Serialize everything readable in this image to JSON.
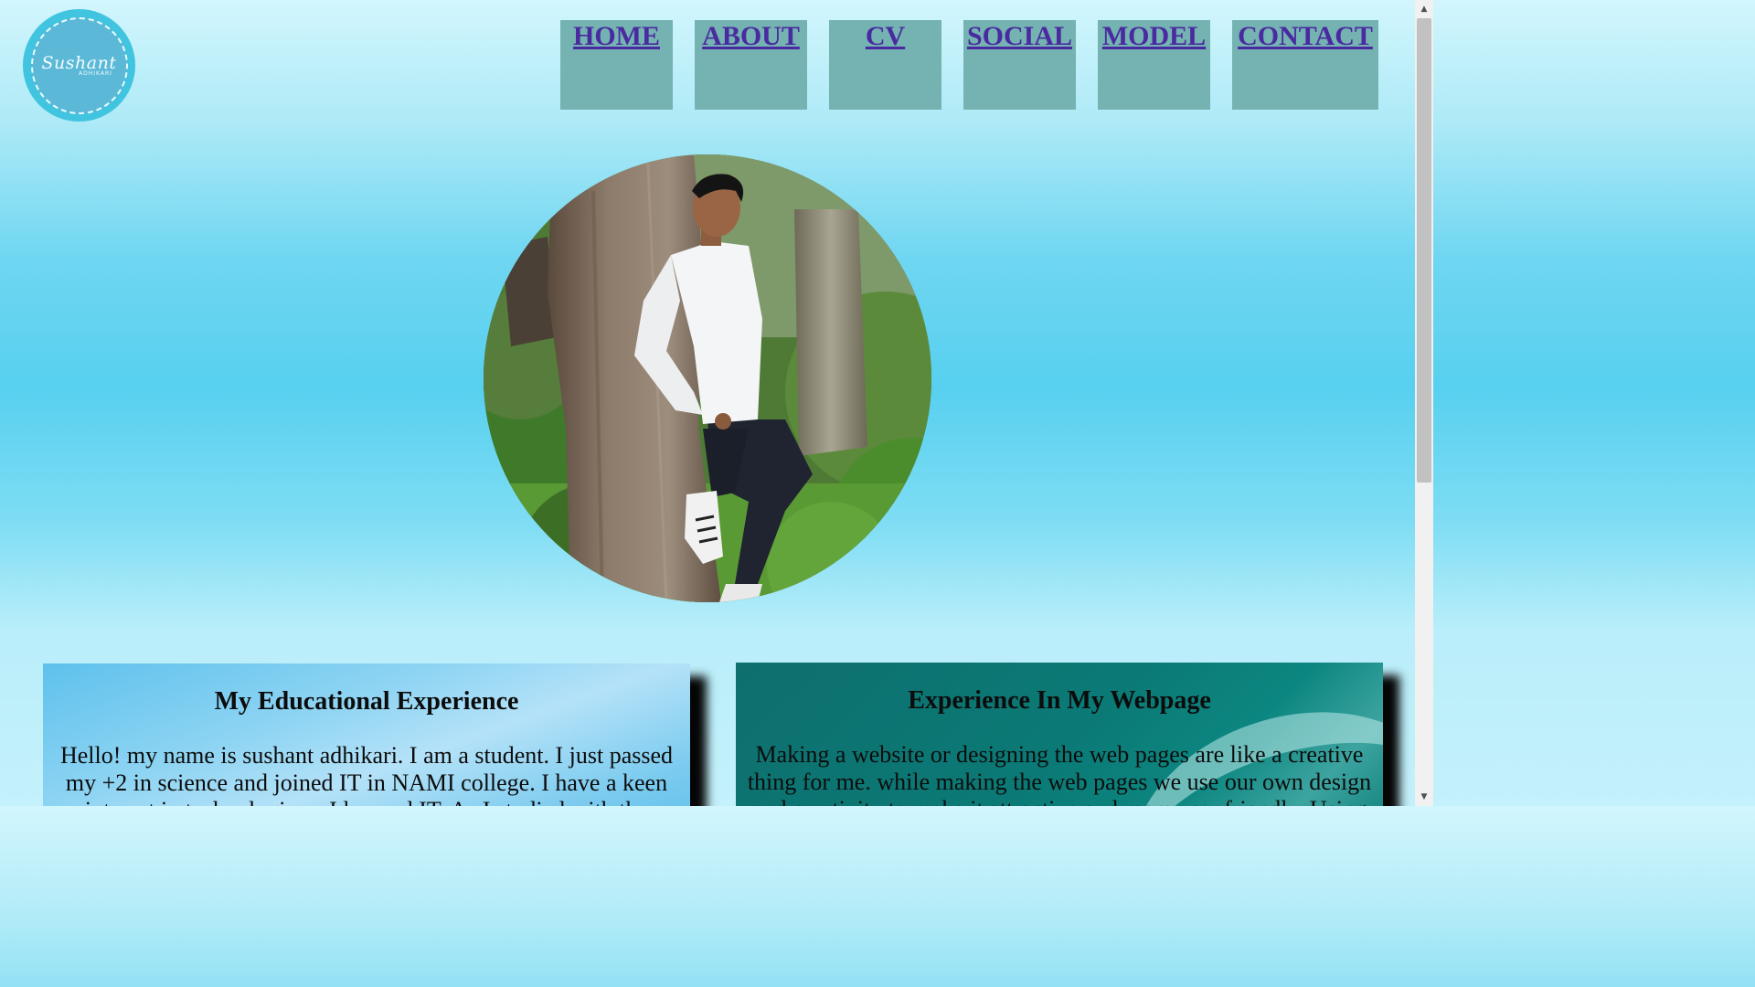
{
  "logo": {
    "script_text": "Sushant",
    "small_text": "ADHIKARI"
  },
  "nav": {
    "items": [
      {
        "label": "HOME"
      },
      {
        "label": "ABOUT"
      },
      {
        "label": "CV"
      },
      {
        "label": "SOCIAL"
      },
      {
        "label": "MODEL"
      },
      {
        "label": "CONTACT"
      }
    ]
  },
  "hero": {
    "image": "profile-photo-man-leaning-on-tree"
  },
  "cards": [
    {
      "title": "My Educational Experience",
      "text": "Hello! my name is sushant adhikari. I am a student. I just passed my +2 in science and joined IT in NAMI college. I have a keen interest in technologies... I learned IT. As I studied with the"
    },
    {
      "title": "Experience In My Webpage",
      "text": "Making a website or designing the web pages are like a creative thing for me. while making the web pages we use our own design and creativity to make it attractive and more user friendly. Using"
    }
  ],
  "colors": {
    "nav_bg": "#74b3b2",
    "nav_link": "#4a2aa0",
    "logo_bg": "#40c4df",
    "card_right_bg": "#0b7a76"
  }
}
